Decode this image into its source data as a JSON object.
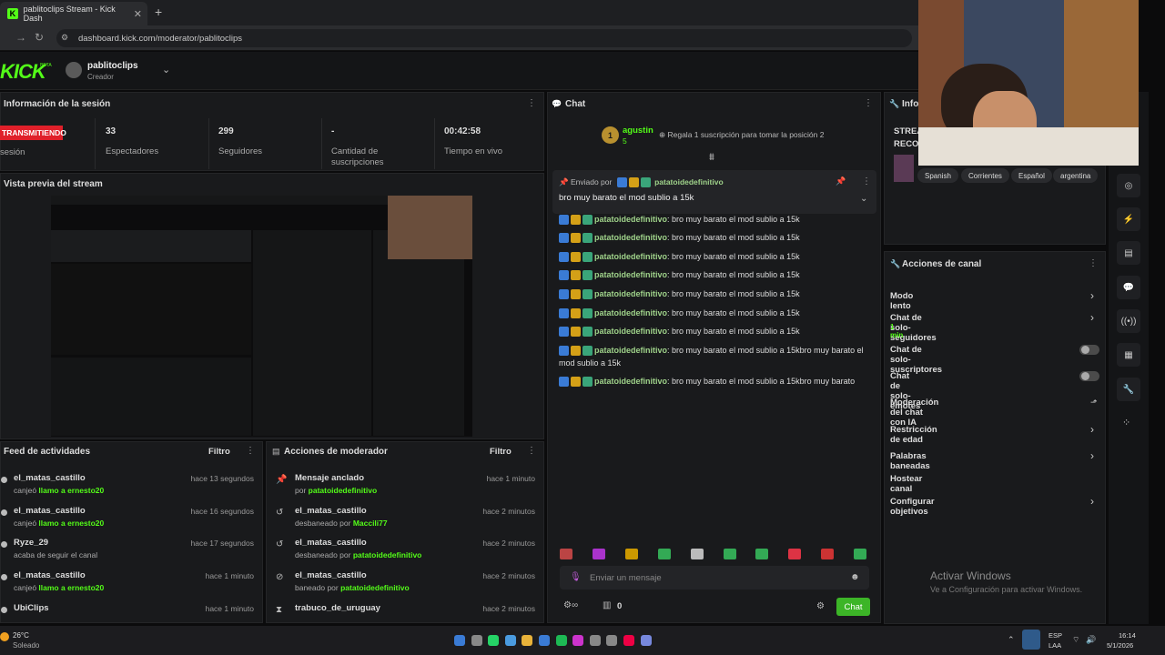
{
  "browser": {
    "tab_title": "pablitoclips Stream - Kick Dash",
    "url": "dashboard.kick.com/moderator/pablitoclips"
  },
  "header": {
    "logo": "KICK",
    "beta": "BETA",
    "channel": "pablitoclips",
    "role": "Creador"
  },
  "session": {
    "title": "Información de la sesión",
    "live_label": "TRANSMITIENDO",
    "live_sub": "sesión",
    "stats": [
      {
        "value": "33",
        "label": "Espectadores"
      },
      {
        "value": "299",
        "label": "Seguidores"
      },
      {
        "value": "-",
        "label": "Cantidad de suscripciones"
      },
      {
        "value": "00:42:58",
        "label": "Tiempo en vivo"
      }
    ]
  },
  "preview": {
    "title": "Vista previa del stream"
  },
  "feed": {
    "title": "Feed de actividades",
    "filter": "Filtro",
    "items": [
      {
        "name": "el_matas_castillo",
        "action": "canjeó ",
        "detail": "llamo a ernesto20",
        "time": "hace 13 segundos"
      },
      {
        "name": "el_matas_castillo",
        "action": "canjeó ",
        "detail": "llamo a ernesto20",
        "time": "hace 16 segundos"
      },
      {
        "name": "Ryze_29",
        "action": "acaba de seguir el canal",
        "detail": "",
        "time": "hace 17 segundos"
      },
      {
        "name": "el_matas_castillo",
        "action": "canjeó ",
        "detail": "llamo a ernesto20",
        "time": "hace 1 minuto"
      },
      {
        "name": "UbiClips",
        "action": "",
        "detail": "",
        "time": "hace 1 minuto"
      }
    ]
  },
  "modactions": {
    "title": "Acciones de moderador",
    "filter": "Filtro",
    "items": [
      {
        "icon": "pin-icon",
        "title": "Mensaje anclado",
        "by": "por ",
        "who": "patatoidedefinitivo",
        "time": "hace 1 minuto"
      },
      {
        "icon": "undo-icon",
        "title": "el_matas_castillo",
        "by": "desbaneado por ",
        "who": "Maccili77",
        "time": "hace 2 minutos"
      },
      {
        "icon": "undo-icon",
        "title": "el_matas_castillo",
        "by": "desbaneado por ",
        "who": "patatoidedefinitivo",
        "time": "hace 2 minutos"
      },
      {
        "icon": "ban-icon",
        "title": "el_matas_castillo",
        "by": "baneado por ",
        "who": "patatoidedefinitivo",
        "time": "hace 2 minutos"
      },
      {
        "icon": "hourglass-icon",
        "title": "trabuco_de_uruguay",
        "by": "",
        "who": "",
        "time": "hace 2 minutos"
      }
    ]
  },
  "chat": {
    "title": "Chat",
    "top_user": "agustin",
    "top_rank": "1",
    "top_count": "5",
    "gift_text": "Regala 1 suscripción para tomar la posición 2",
    "pinned_label": "Enviado por",
    "pinned_user": "patatoidedefinitivo",
    "pinned_message": "bro muy barato el mod sublio a 15k",
    "messages": [
      {
        "user": "patatoidedefinitivo",
        "text": "bro muy barato el mod sublio a 15k"
      },
      {
        "user": "patatoidedefinitivo",
        "text": "bro muy barato el mod sublio a 15k"
      },
      {
        "user": "patatoidedefinitivo",
        "text": "bro muy barato el mod sublio a 15k"
      },
      {
        "user": "patatoidedefinitivo",
        "text": "bro muy barato el mod sublio a 15k"
      },
      {
        "user": "patatoidedefinitivo",
        "text": "bro muy barato el mod sublio a 15k"
      },
      {
        "user": "patatoidedefinitivo",
        "text": "bro muy barato el mod sublio a 15k"
      },
      {
        "user": "patatoidedefinitivo",
        "text": "bro muy barato el mod sublio a 15k"
      },
      {
        "user": "patatoidedefinitivo",
        "text": "bro muy barato el mod sublio a 15kbro muy barato el mod sublio a 15k"
      },
      {
        "user": "patatoidedefinitivo",
        "text": "bro muy barato el mod sublio a 15kbro muy barato"
      }
    ],
    "placeholder": "Enviar un mensaje",
    "count": "0",
    "send": "Chat"
  },
  "info": {
    "title": "Info",
    "title_line1": "STREA",
    "title_line2": "RECO",
    "tags": [
      "Spanish",
      "Corrientes",
      "Español",
      "argentina"
    ]
  },
  "actions": {
    "title": "Acciones de canal",
    "items": [
      {
        "label": "Modo lento",
        "control": "arrow"
      },
      {
        "label": "Chat de solo-seguidores",
        "sub": "1 min",
        "control": "arrow"
      },
      {
        "label": "Chat de solo-suscriptores",
        "control": "toggle"
      },
      {
        "label": "Chat de solo-emotes",
        "control": "toggle"
      },
      {
        "label": "Moderación del chat con IA",
        "control": "chart"
      },
      {
        "label": "Restricción de edad",
        "control": "arrow"
      },
      {
        "label": "Palabras baneadas",
        "control": "arrow"
      },
      {
        "label": "Hostear canal",
        "control": "none"
      },
      {
        "label": "Configurar objetivos",
        "control": "arrow"
      }
    ]
  },
  "windows": {
    "activate_title": "Activar Windows",
    "activate_sub": "Ve a Configuración para activar Windows."
  },
  "taskbar": {
    "temp": "26°C",
    "weather": "Soleado",
    "lang1": "ESP",
    "lang2": "LAA",
    "time": "16:14",
    "date": "5/1/2026"
  },
  "colors": {
    "accent": "#53fc18",
    "live": "#e0202a",
    "panel": "#191a1c"
  }
}
